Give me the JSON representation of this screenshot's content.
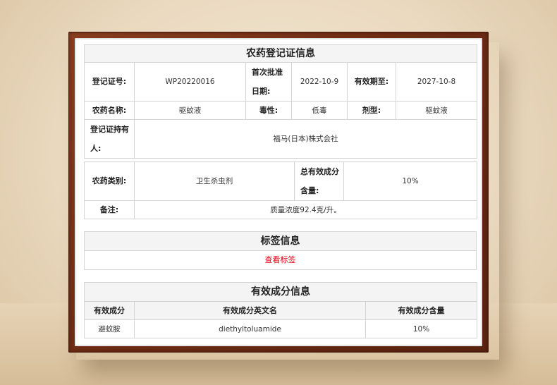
{
  "registration": {
    "title": "农药登记证信息",
    "reg_no_label": "登记证号:",
    "reg_no": "WP20220016",
    "first_approval_label": "首次批准日期:",
    "first_approval": "2022-10-9",
    "valid_until_label": "有效期至:",
    "valid_until": "2027-10-8",
    "name_label": "农药名称:",
    "name": "驱蚊液",
    "toxicity_label": "毒性:",
    "toxicity": "低毒",
    "form_label": "剂型:",
    "form": "驱蚊液",
    "holder_label": "登记证持有人:",
    "holder": "福马(日本)株式会社",
    "category_label": "农药类别:",
    "category": "卫生杀虫剂",
    "total_content_label": "总有效成分含量:",
    "total_content": "10%",
    "remark_label": "备注:",
    "remark": "质量浓度92.4克/升。"
  },
  "label_info": {
    "title": "标签信息",
    "link": "查看标签"
  },
  "ingredients": {
    "title": "有效成分信息",
    "headers": [
      "有效成分",
      "有效成分英文名",
      "有效成分含量"
    ],
    "rows": [
      [
        "避蚊胺",
        "diethyltoluamide",
        "10%"
      ]
    ]
  }
}
